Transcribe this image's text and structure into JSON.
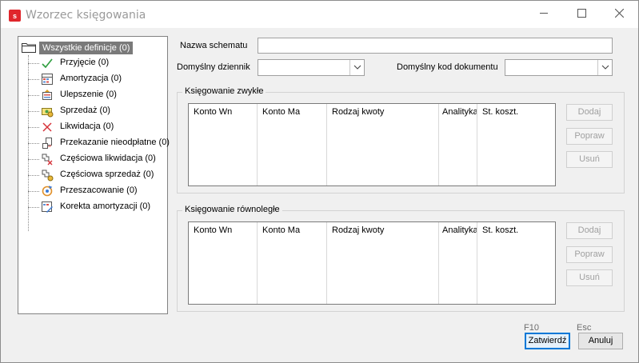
{
  "window": {
    "title": "Wzorzec księgowania",
    "app_icon_letter": "s",
    "controls": [
      "minimize-icon",
      "maximize-icon",
      "close-icon"
    ]
  },
  "tree": {
    "root_label": "Wszystkie definicje (0)",
    "items": [
      {
        "label": "Przyjęcie (0)",
        "icon": "check-icon"
      },
      {
        "label": "Amortyzacja (0)",
        "icon": "amortization-icon"
      },
      {
        "label": "Ulepszenie (0)",
        "icon": "upgrade-icon"
      },
      {
        "label": "Sprzedaż (0)",
        "icon": "sale-icon"
      },
      {
        "label": "Likwidacja (0)",
        "icon": "cross-icon"
      },
      {
        "label": "Przekazanie nieodpłatne (0)",
        "icon": "transfer-icon"
      },
      {
        "label": "Częściowa likwidacja (0)",
        "icon": "partial-liquidation-icon"
      },
      {
        "label": "Częściowa sprzedaż (0)",
        "icon": "partial-sale-icon"
      },
      {
        "label": "Przeszacowanie (0)",
        "icon": "revaluation-icon"
      },
      {
        "label": "Korekta amortyzacji (0)",
        "icon": "amortization-correction-icon"
      }
    ]
  },
  "form": {
    "scheme_name_label": "Nazwa schematu",
    "scheme_name_value": "",
    "journal_label": "Domyślny dziennik",
    "journal_value": "",
    "doc_code_label": "Domyślny kod dokumentu",
    "doc_code_value": ""
  },
  "groups": {
    "regular": {
      "title": "Księgowanie zwykłe",
      "columns": [
        "Konto Wn",
        "Konto Ma",
        "Rodzaj kwoty",
        "Analityka",
        "St. koszt."
      ],
      "buttons": {
        "add": "Dodaj",
        "edit": "Popraw",
        "delete": "Usuń"
      }
    },
    "parallel": {
      "title": "Księgowanie równoległe",
      "columns": [
        "Konto Wn",
        "Konto Ma",
        "Rodzaj kwoty",
        "Analityka",
        "St. koszt."
      ],
      "buttons": {
        "add": "Dodaj",
        "edit": "Popraw",
        "delete": "Usuń"
      }
    }
  },
  "footer": {
    "confirm_key": "F10",
    "confirm_label": "Zatwierdź",
    "cancel_key": "Esc",
    "cancel_label": "Anuluj"
  },
  "colors": {
    "accent": "#0078d7",
    "app_icon": "#e0262b",
    "selection": "#7a7a7a"
  }
}
